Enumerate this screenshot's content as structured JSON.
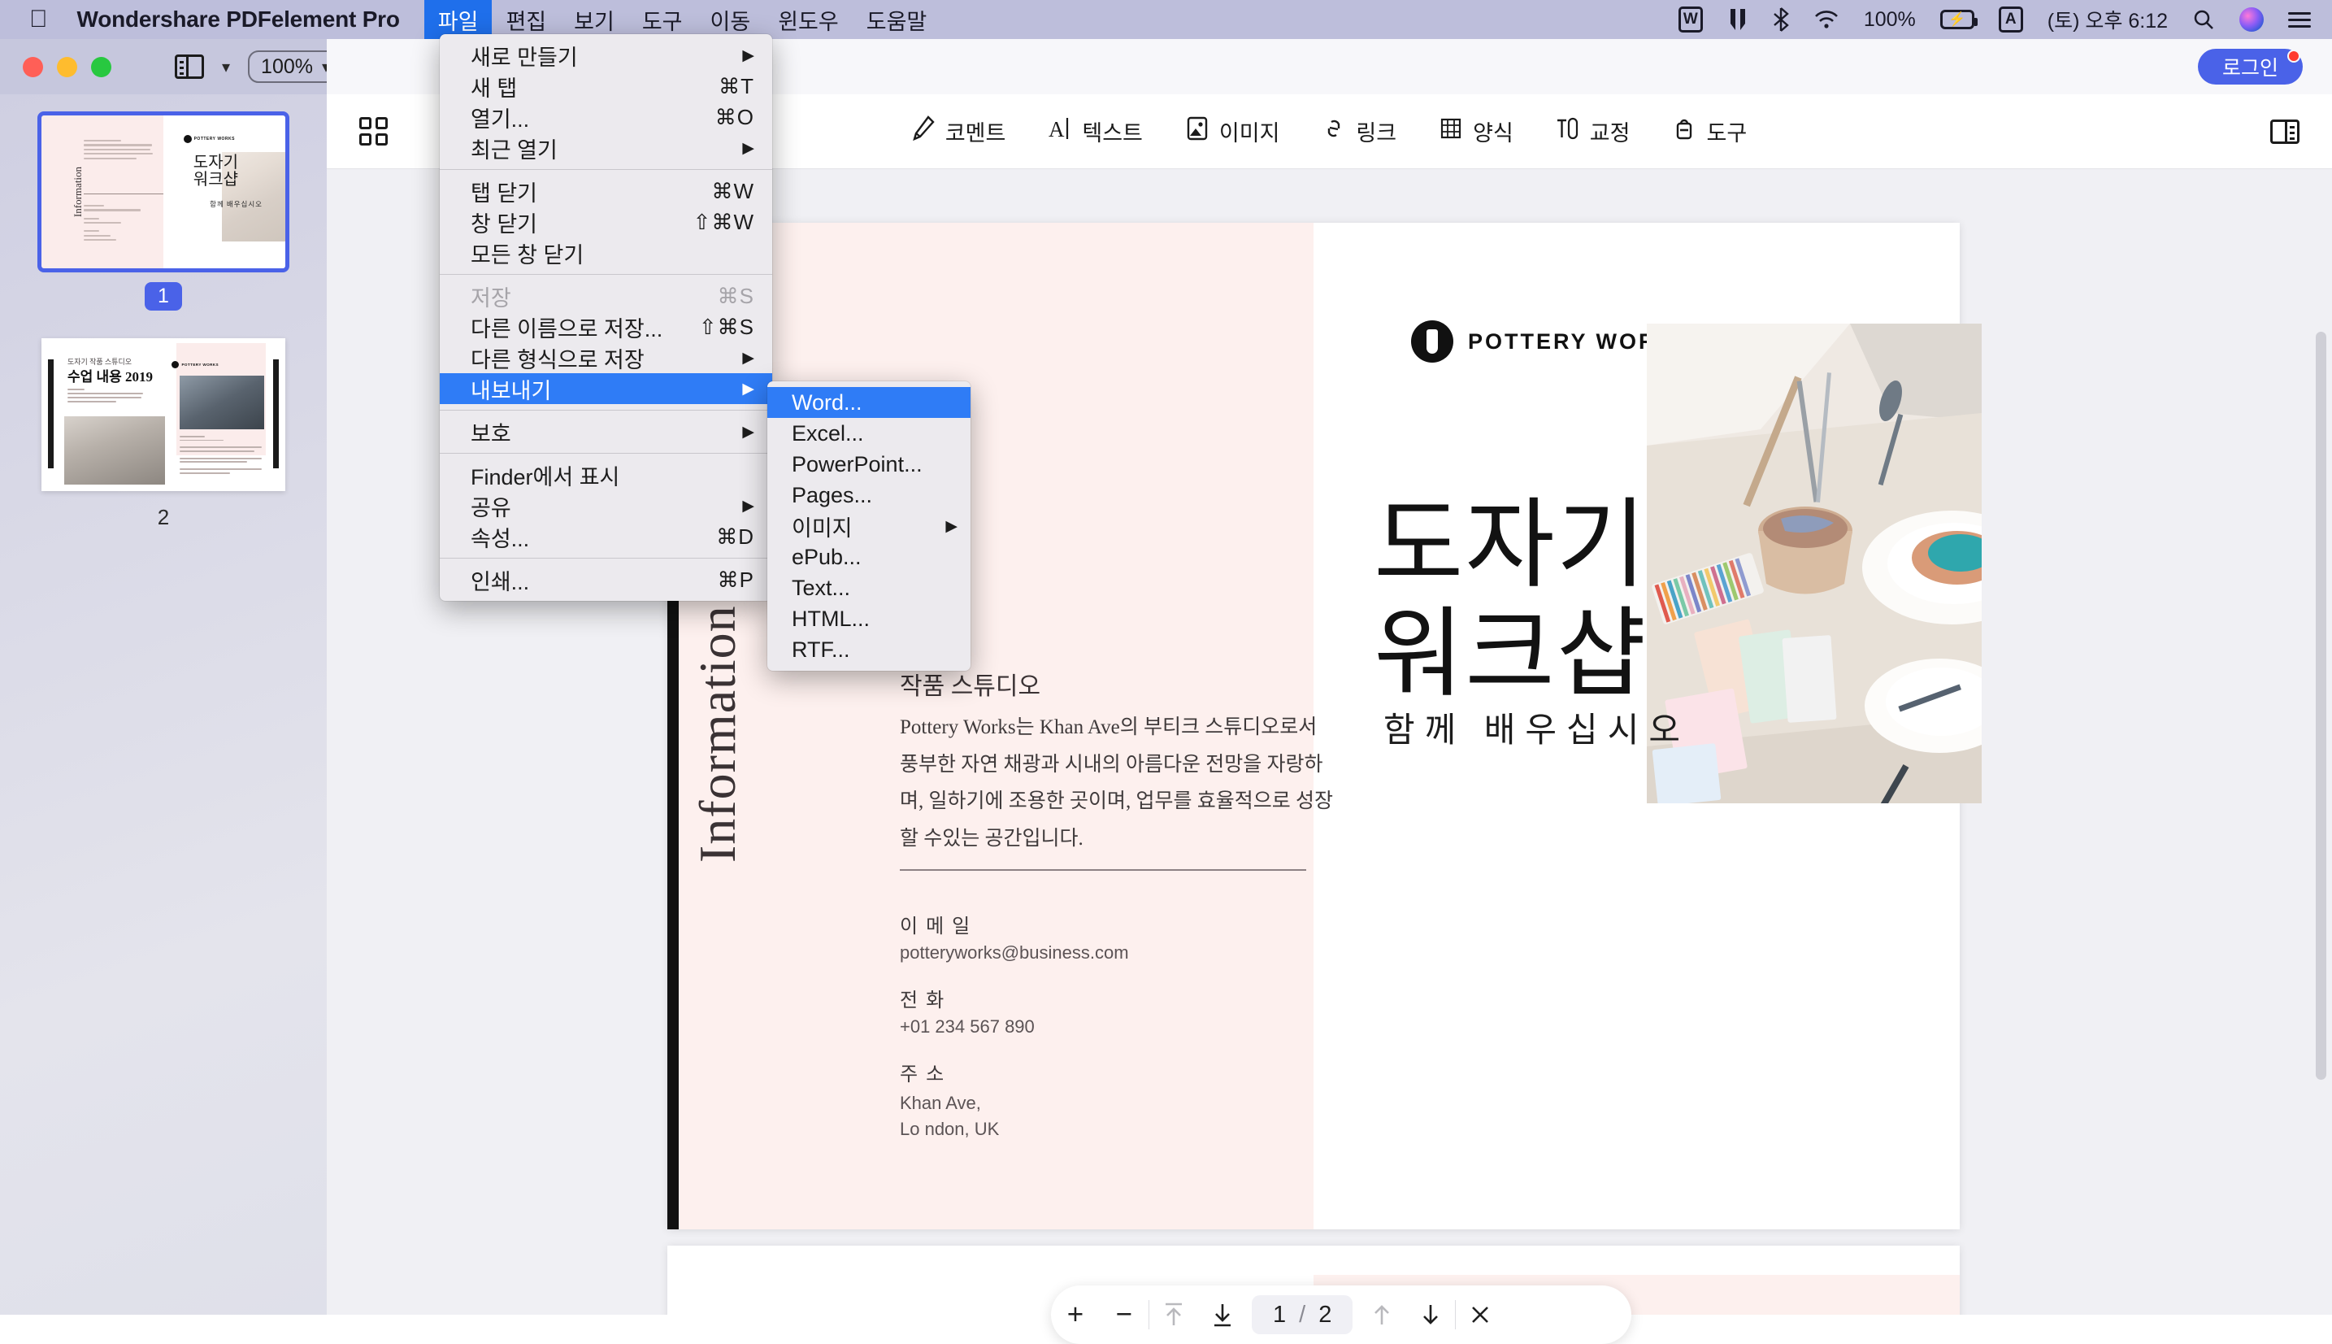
{
  "menubar": {
    "apple_icon": "apple-logo",
    "app_name": "Wondershare PDFelement Pro",
    "items": [
      {
        "label": "파일",
        "active": true
      },
      {
        "label": "편집",
        "active": false
      },
      {
        "label": "보기",
        "active": false
      },
      {
        "label": "도구",
        "active": false
      },
      {
        "label": "이동",
        "active": false
      },
      {
        "label": "윈도우",
        "active": false
      },
      {
        "label": "도움말",
        "active": false
      }
    ],
    "status": {
      "wps_icon": "W",
      "bluetooth_icon": "bluetooth-icon",
      "wifi_icon": "wifi-icon",
      "battery_percent": "100%",
      "battery_icon": "battery-charging-icon",
      "input_source": "A",
      "clock": "(토) 오후 6:12",
      "search_icon": "search-icon",
      "siri_icon": "siri-icon",
      "control_center_icon": "control-center-icon"
    }
  },
  "titlebar": {
    "sidebar_toggle_icon": "sidebar-panel-icon",
    "chevron_icon": "chevron-down-icon",
    "zoom_level": "100%",
    "login_label": "로그인"
  },
  "toolbar": {
    "grid_icon": "grid-view-icon",
    "tabs": [
      {
        "label": "코멘트",
        "icon": "comment-pen-icon"
      },
      {
        "label": "텍스트",
        "icon": "text-edit-icon"
      },
      {
        "label": "이미지",
        "icon": "image-icon"
      },
      {
        "label": "링크",
        "icon": "link-icon"
      },
      {
        "label": "양식",
        "icon": "form-grid-icon"
      },
      {
        "label": "교정",
        "icon": "ocr-icon"
      },
      {
        "label": "도구",
        "icon": "tools-icon"
      }
    ],
    "right_panel_icon": "right-panel-toggle-icon"
  },
  "sidebar": {
    "thumbnails": [
      {
        "number": "1",
        "selected": true
      },
      {
        "number": "2",
        "selected": false
      }
    ],
    "page2_preview": {
      "kicker": "도자기 작품 스튜디오",
      "heading": "수업 내용 2019"
    }
  },
  "file_menu": {
    "groups": [
      [
        {
          "label": "새로 만들기",
          "shortcut": "",
          "arrow": true,
          "disabled": false,
          "selected": false
        },
        {
          "label": "새 탭",
          "shortcut": "⌘T",
          "arrow": false,
          "disabled": false,
          "selected": false
        },
        {
          "label": "열기...",
          "shortcut": "⌘O",
          "arrow": false,
          "disabled": false,
          "selected": false
        },
        {
          "label": "최근 열기",
          "shortcut": "",
          "arrow": true,
          "disabled": false,
          "selected": false
        }
      ],
      [
        {
          "label": "탭 닫기",
          "shortcut": "⌘W",
          "arrow": false,
          "disabled": false,
          "selected": false
        },
        {
          "label": "창 닫기",
          "shortcut": "⇧⌘W",
          "arrow": false,
          "disabled": false,
          "selected": false
        },
        {
          "label": "모든 창 닫기",
          "shortcut": "",
          "arrow": false,
          "disabled": false,
          "selected": false
        }
      ],
      [
        {
          "label": "저장",
          "shortcut": "⌘S",
          "arrow": false,
          "disabled": true,
          "selected": false
        },
        {
          "label": "다른 이름으로 저장...",
          "shortcut": "⇧⌘S",
          "arrow": false,
          "disabled": false,
          "selected": false
        },
        {
          "label": "다른 형식으로 저장",
          "shortcut": "",
          "arrow": true,
          "disabled": false,
          "selected": false
        },
        {
          "label": "내보내기",
          "shortcut": "",
          "arrow": true,
          "disabled": false,
          "selected": true
        }
      ],
      [
        {
          "label": "보호",
          "shortcut": "",
          "arrow": true,
          "disabled": false,
          "selected": false
        }
      ],
      [
        {
          "label": "Finder에서 표시",
          "shortcut": "",
          "arrow": false,
          "disabled": false,
          "selected": false
        },
        {
          "label": "공유",
          "shortcut": "",
          "arrow": true,
          "disabled": false,
          "selected": false
        },
        {
          "label": "속성...",
          "shortcut": "⌘D",
          "arrow": false,
          "disabled": false,
          "selected": false
        }
      ],
      [
        {
          "label": "인쇄...",
          "shortcut": "⌘P",
          "arrow": false,
          "disabled": false,
          "selected": false
        }
      ]
    ]
  },
  "export_submenu": {
    "items": [
      {
        "label": "Word...",
        "arrow": false,
        "selected": true
      },
      {
        "label": "Excel...",
        "arrow": false,
        "selected": false
      },
      {
        "label": "PowerPoint...",
        "arrow": false,
        "selected": false
      },
      {
        "label": "Pages...",
        "arrow": false,
        "selected": false
      },
      {
        "label": "이미지",
        "arrow": true,
        "selected": false
      },
      {
        "label": "ePub...",
        "arrow": false,
        "selected": false
      },
      {
        "label": "Text...",
        "arrow": false,
        "selected": false
      },
      {
        "label": "HTML...",
        "arrow": false,
        "selected": false
      },
      {
        "label": "RTF...",
        "arrow": false,
        "selected": false
      }
    ]
  },
  "document": {
    "left_page": {
      "vertical_label": "Information",
      "section_title": "작품 스튜디오",
      "body": "Pottery Works는 Khan Ave의 부티크 스튜디오로서 풍부한 자연 채광과 시내의 아름다운 전망을 자랑하며, 일하기에 조용한 곳이며, 업무를 효율적으로 성장할 수있는 공간입니다.",
      "fields": [
        {
          "label": "이 메 일",
          "value": "potteryworks@business.com"
        },
        {
          "label": "전 화",
          "value": "+01 234 567 890"
        },
        {
          "label": "주 소",
          "value": "Khan Ave,\nLo ndon, UK"
        }
      ]
    },
    "right_page": {
      "logo_text": "POTTERY WORKS",
      "title_line1": "도자기",
      "title_line2": "워크샵",
      "subtitle": "함께 배우십시오"
    }
  },
  "page_nav": {
    "zoom_in": "+",
    "zoom_out": "−",
    "first_page_icon": "arrow-up-to-line-icon",
    "last_page_icon": "arrow-down-to-line-icon",
    "current_page": "1",
    "separator": "/",
    "total_pages": "2",
    "prev_page_icon": "arrow-up-icon",
    "next_page_icon": "arrow-down-icon",
    "close_icon": "close-icon"
  },
  "colors": {
    "menubar_bg": "#bdbedb",
    "accent_blue": "#2f7cf6",
    "login_blue": "#4a62e8",
    "page_pink": "#fdf0ee",
    "notif_red": "#ff3b30"
  }
}
